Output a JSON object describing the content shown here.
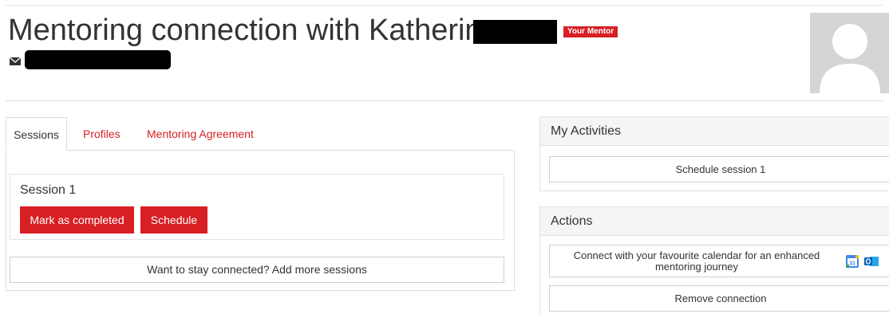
{
  "header": {
    "title": "Mentoring connection with Katherine",
    "badge": "Your Mentor",
    "email_icon": "envelope-icon",
    "avatar": "user-avatar-placeholder"
  },
  "tabs": [
    {
      "label": "Sessions",
      "active": true
    },
    {
      "label": "Profiles",
      "active": false
    },
    {
      "label": "Mentoring Agreement",
      "active": false
    }
  ],
  "session": {
    "title": "Session 1",
    "mark_completed_label": "Mark as completed",
    "schedule_label": "Schedule"
  },
  "add_sessions_label": "Want to stay connected? Add more sessions",
  "activities": {
    "heading": "My Activities",
    "schedule_session_label": "Schedule session 1"
  },
  "actions": {
    "heading": "Actions",
    "calendar_label": "Connect with your favourite calendar for an enhanced mentoring journey",
    "calendar_icons": [
      "google-calendar-icon",
      "outlook-icon"
    ],
    "remove_label": "Remove connection"
  },
  "colors": {
    "accent": "#d71f24",
    "panel_header_bg": "#f5f5f5",
    "border": "#dcdcdc"
  }
}
